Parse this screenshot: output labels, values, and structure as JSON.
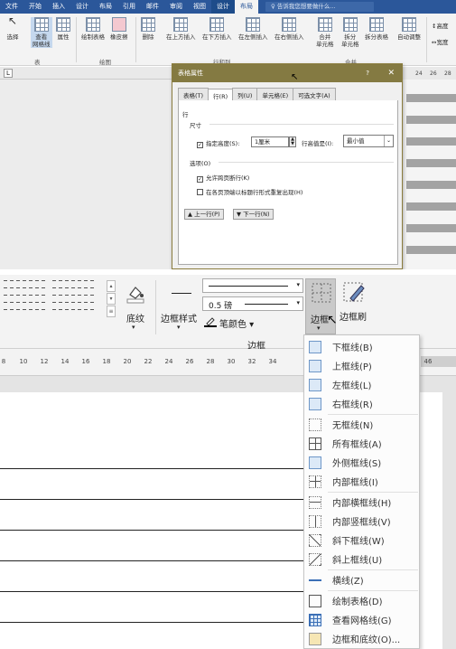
{
  "tabs": [
    "文件",
    "开始",
    "插入",
    "设计",
    "布局",
    "引用",
    "邮件",
    "审阅",
    "视图",
    "设计",
    "布局"
  ],
  "tell_me": "告诉我您想要做什么...",
  "ribbon": {
    "buttons": [
      "选择",
      "查看\n网格线",
      "属性",
      "绘制表格",
      "橡皮擦",
      "删除",
      "在上方插入",
      "在下方插入",
      "在左侧插入",
      "在右侧插入",
      "合并\n单元格",
      "拆分\n单元格",
      "拆分表格",
      "自动调整"
    ],
    "groups": [
      "表",
      "绘图",
      "行和列",
      "合并"
    ],
    "right_items": [
      "高度",
      "宽度"
    ]
  },
  "ruler_top": [
    "24",
    "26",
    "28"
  ],
  "dialog": {
    "title": "表格属性",
    "help": "?",
    "close": "✕",
    "tabs": [
      "表格(T)",
      "行(R)",
      "列(U)",
      "单元格(E)",
      "可选文字(A)"
    ],
    "section_row": "行",
    "section_size": "尺寸",
    "specify_height_label": "指定高度(S):",
    "height_value": "1厘米",
    "row_height_label": "行高值是(I):",
    "row_height_value": "最小值",
    "section_options": "选项(O)",
    "allow_break": "允许跨页断行(K)",
    "repeat_header": "在各页顶端以标题行形式重复出现(H)",
    "prev_row": "▲ 上一行(P)",
    "next_row": "▼ 下一行(N)"
  },
  "ribbon2": {
    "shading_label": "底纹",
    "border_style_label": "边框样式",
    "weight_value": "0.5 磅",
    "pen_color_label": "笔颜色",
    "border_btn_label": "边框",
    "border_painter_label": "边框刷",
    "group_label": "边框"
  },
  "ruler_ticks": [
    "8",
    "10",
    "12",
    "14",
    "16",
    "18",
    "20",
    "22",
    "24",
    "26",
    "28",
    "30",
    "32",
    "34",
    "46"
  ],
  "border_menu": [
    {
      "label": "下框线(B)",
      "icon": "bottom-border-icon"
    },
    {
      "label": "上框线(P)",
      "icon": "top-border-icon"
    },
    {
      "label": "左框线(L)",
      "icon": "left-border-icon"
    },
    {
      "label": "右框线(R)",
      "icon": "right-border-icon"
    },
    {
      "label": "无框线(N)",
      "icon": "no-border-icon"
    },
    {
      "label": "所有框线(A)",
      "icon": "all-borders-icon"
    },
    {
      "label": "外侧框线(S)",
      "icon": "outside-borders-icon"
    },
    {
      "label": "内部框线(I)",
      "icon": "inside-borders-icon"
    },
    {
      "label": "内部横框线(H)",
      "icon": "inside-horizontal-border-icon"
    },
    {
      "label": "内部竖框线(V)",
      "icon": "inside-vertical-border-icon"
    },
    {
      "label": "斜下框线(W)",
      "icon": "diagonal-down-border-icon"
    },
    {
      "label": "斜上框线(U)",
      "icon": "diagonal-up-border-icon"
    },
    {
      "label": "横线(Z)",
      "icon": "horizontal-line-icon"
    },
    {
      "label": "绘制表格(D)",
      "icon": "draw-table-icon"
    },
    {
      "label": "查看网格线(G)",
      "icon": "view-gridlines-icon"
    },
    {
      "label": "边框和底纹(O)...",
      "icon": "borders-shading-icon"
    }
  ]
}
